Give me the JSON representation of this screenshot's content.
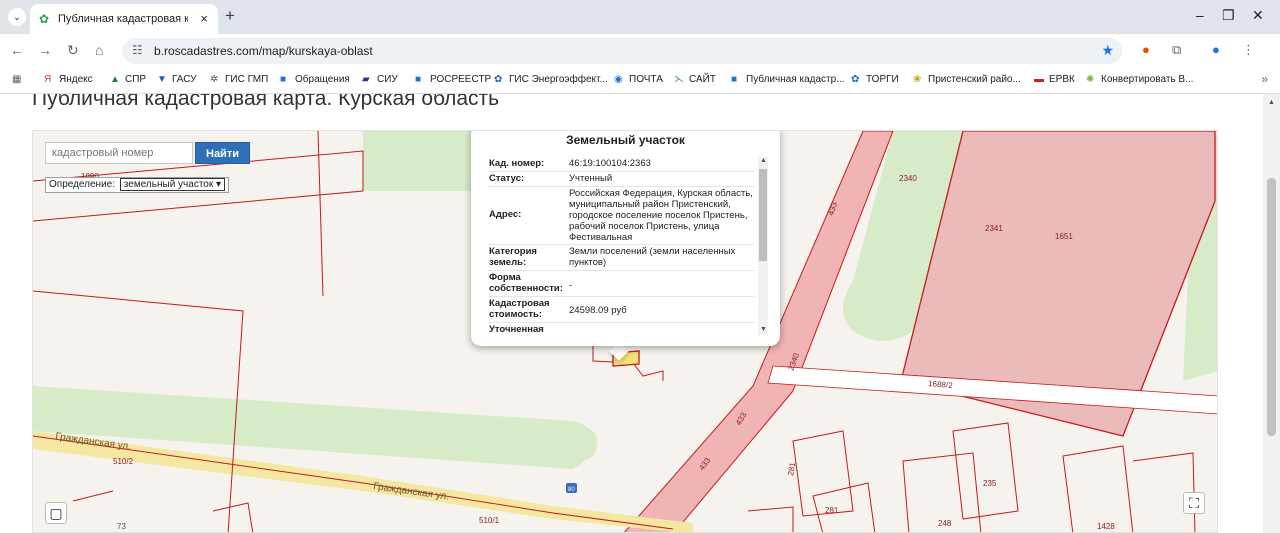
{
  "browser": {
    "tab_title": "Публичная кадастровая карта",
    "url": "b.roscadastres.com/map/kurskaya-oblast",
    "bookmarks": [
      {
        "label": "Яндекс",
        "icon": "yandex-icon",
        "color": "#e53935"
      },
      {
        "label": "СПР",
        "icon": "spr-icon",
        "color": "#2e7d32"
      },
      {
        "label": "ГАСУ",
        "icon": "gasu-icon",
        "color": "#1565c0"
      },
      {
        "label": "ГИС ГМП",
        "icon": "gis-gmp-icon",
        "color": "#555555"
      },
      {
        "label": "Обращения",
        "icon": "appeals-icon",
        "color": "#1976d2"
      },
      {
        "label": "СИУ",
        "icon": "siu-icon",
        "color": "#283593"
      },
      {
        "label": "РОСРЕЕСТР",
        "icon": "rosreestr-icon",
        "color": "#1976d2"
      },
      {
        "label": "ГИС Энергоэффект...",
        "icon": "gis-energy-icon",
        "color": "#1565c0"
      },
      {
        "label": "ПОЧТА",
        "icon": "mail-icon",
        "color": "#1976d2"
      },
      {
        "label": "САЙТ",
        "icon": "site-icon",
        "color": "#43a047"
      },
      {
        "label": "Публичная кадастр...",
        "icon": "cadastre-icon",
        "color": "#1976d2"
      },
      {
        "label": "ТОРГИ",
        "icon": "torgi-icon",
        "color": "#1565c0"
      },
      {
        "label": "Пристенский райо...",
        "icon": "pristen-icon",
        "color": "#c8a000"
      },
      {
        "label": "ЕРВК",
        "icon": "ervk-icon",
        "color": "#c62828"
      },
      {
        "label": "Конвертировать В...",
        "icon": "convert-icon",
        "color": "#7cb342"
      }
    ]
  },
  "page": {
    "title": "Публичная кадастровая карта. Курская область"
  },
  "map": {
    "search_placeholder": "кадастровый номер",
    "search_button": "Найти",
    "definition_label": "Определение:",
    "definition_value": "земельный участок",
    "street_labels": [
      "Гражданская ул.",
      "Гражданская ул."
    ],
    "parcel_labels": [
      "1890",
      "2340",
      "2341",
      "1651",
      "433",
      "433",
      "433",
      "2340",
      "1688/2",
      "281",
      "281",
      "235",
      "248",
      "1428",
      "73",
      "510/2",
      "510/1",
      "80"
    ]
  },
  "popup": {
    "title": "Земельный участок",
    "rows": [
      {
        "key": "Кад. номер:",
        "value": "46:19:100104:2363"
      },
      {
        "key": "Статус:",
        "value": "Учтенный"
      },
      {
        "key": "Адрес:",
        "value": "Российская Федерация, Курская область, муниципальный район Пристенский, городское поселение поселок Пристень, рабочий поселок Пристень, улица Фестивальная"
      },
      {
        "key": "Категория земель:",
        "value": "Земли поселений (земли населенных пунктов)"
      },
      {
        "key": "Форма собственности:",
        "value": "-"
      },
      {
        "key": "Кадастровая стоимость:",
        "value": "24598.09 руб"
      },
      {
        "key": "Уточненная",
        "value": ""
      }
    ]
  }
}
